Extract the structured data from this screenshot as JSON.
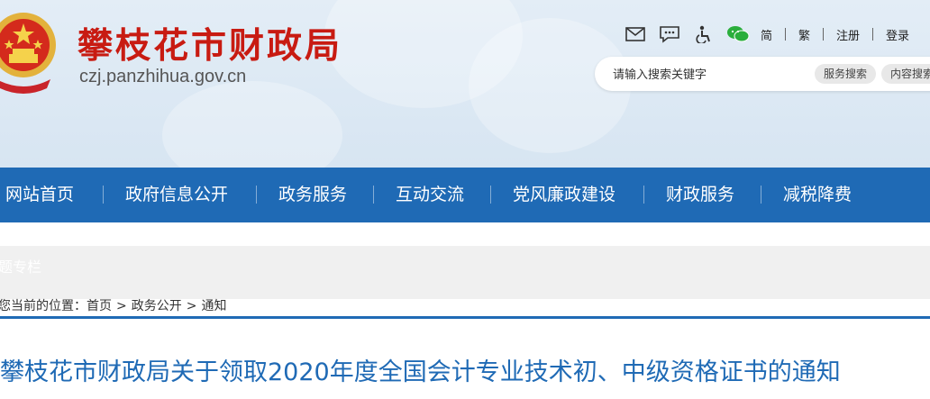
{
  "header": {
    "site_title": "攀枝花市财政局",
    "site_domain": "czj.panzhihua.gov.cn",
    "tools": {
      "icons": [
        "mail-icon",
        "message-icon",
        "accessibility-icon",
        "wechat-icon"
      ],
      "links": [
        "简",
        "繁",
        "注册",
        "登录"
      ]
    },
    "search": {
      "placeholder": "请输入搜索关键字",
      "service_button": "服务搜索",
      "content_button": "内容搜索"
    }
  },
  "nav": {
    "items": [
      "网站首页",
      "政府信息公开",
      "政务服务",
      "互动交流",
      "党风廉政建设",
      "财政服务",
      "减税降费"
    ]
  },
  "banner": {
    "text": "题专栏"
  },
  "breadcrumb": {
    "prefix": "您当前的位置：",
    "items": [
      "首页",
      "政务公开",
      "通知"
    ],
    "separator": ">"
  },
  "article": {
    "title": "攀枝花市财政局关于领取2020年度全国会计专业技术初、中级资格证书的通知"
  },
  "colors": {
    "brand_red": "#c81b12",
    "nav_blue": "#1f6ab5",
    "header_bg": "#dce8f4"
  }
}
